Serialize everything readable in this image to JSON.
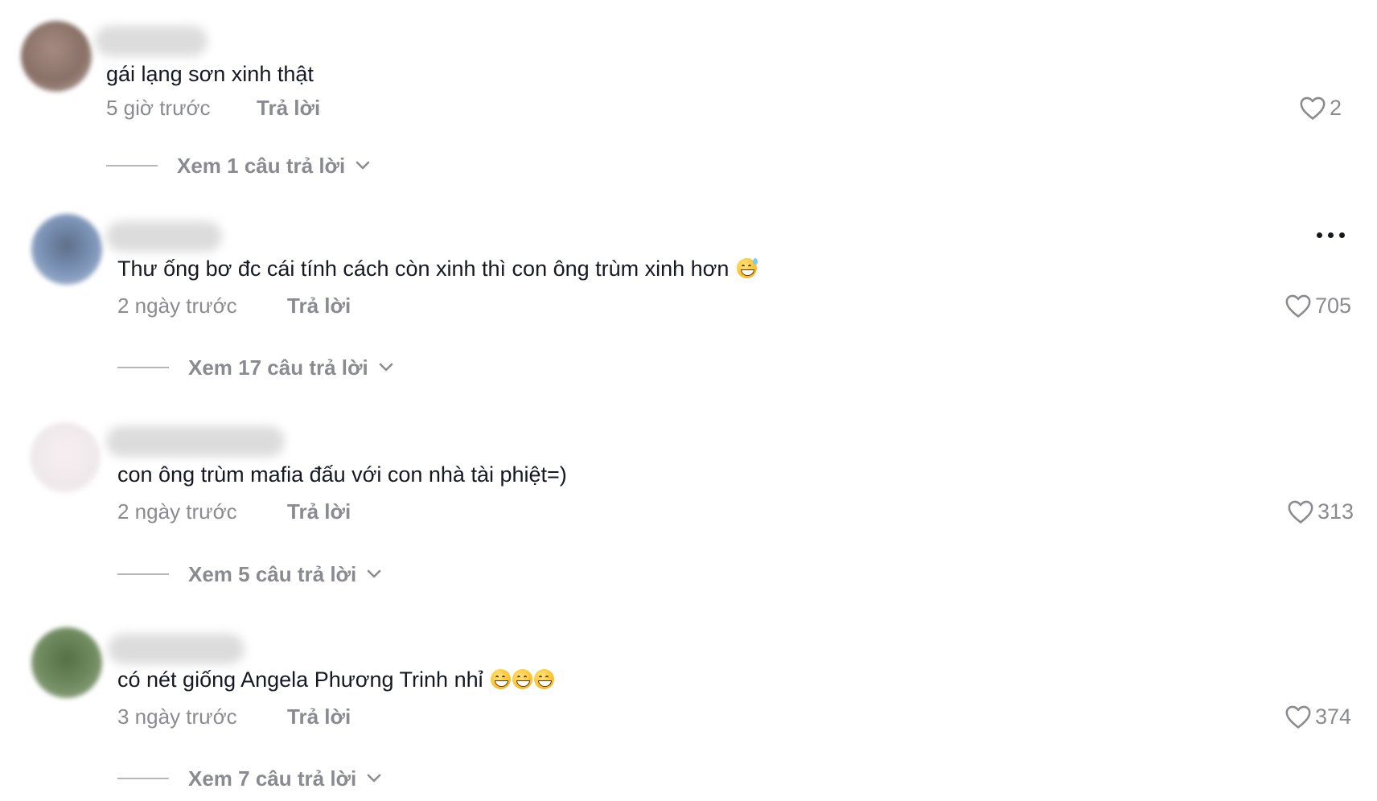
{
  "comments": [
    {
      "text": "gái lạng sơn xinh thật",
      "emoji": [],
      "time": "5 giờ trước",
      "reply_label": "Trả lời",
      "likes": "2",
      "view_replies": "Xem 1 câu trả lời",
      "avatar_color": "#8a7168"
    },
    {
      "text": "Thư ống bơ đc cái tính cách còn xinh thì con ông trùm xinh hơn",
      "emoji": [
        "grinning-sweat-emoji"
      ],
      "time": "2 ngày trước",
      "reply_label": "Trả lời",
      "likes": "705",
      "view_replies": "Xem 17 câu trả lời",
      "avatar_color": "#7c93b7"
    },
    {
      "text": "con ông trùm mafia đấu với con nhà tài phiệt=)",
      "emoji": [],
      "time": "2 ngày trước",
      "reply_label": "Trả lời",
      "likes": "313",
      "view_replies": "Xem 5 câu trả lời",
      "avatar_color": "#f0e9eb"
    },
    {
      "text": "có nét giống Angela Phương Trinh nhỉ",
      "emoji": [
        "grinning-emoji",
        "grinning-emoji",
        "grinning-emoji"
      ],
      "time": "3 ngày trước",
      "reply_label": "Trả lời",
      "likes": "374",
      "view_replies": "Xem 7 câu trả lời",
      "avatar_color": "#6f8a5e"
    }
  ],
  "colors": {
    "text_primary": "#161823",
    "text_secondary": "#8a8b91"
  }
}
